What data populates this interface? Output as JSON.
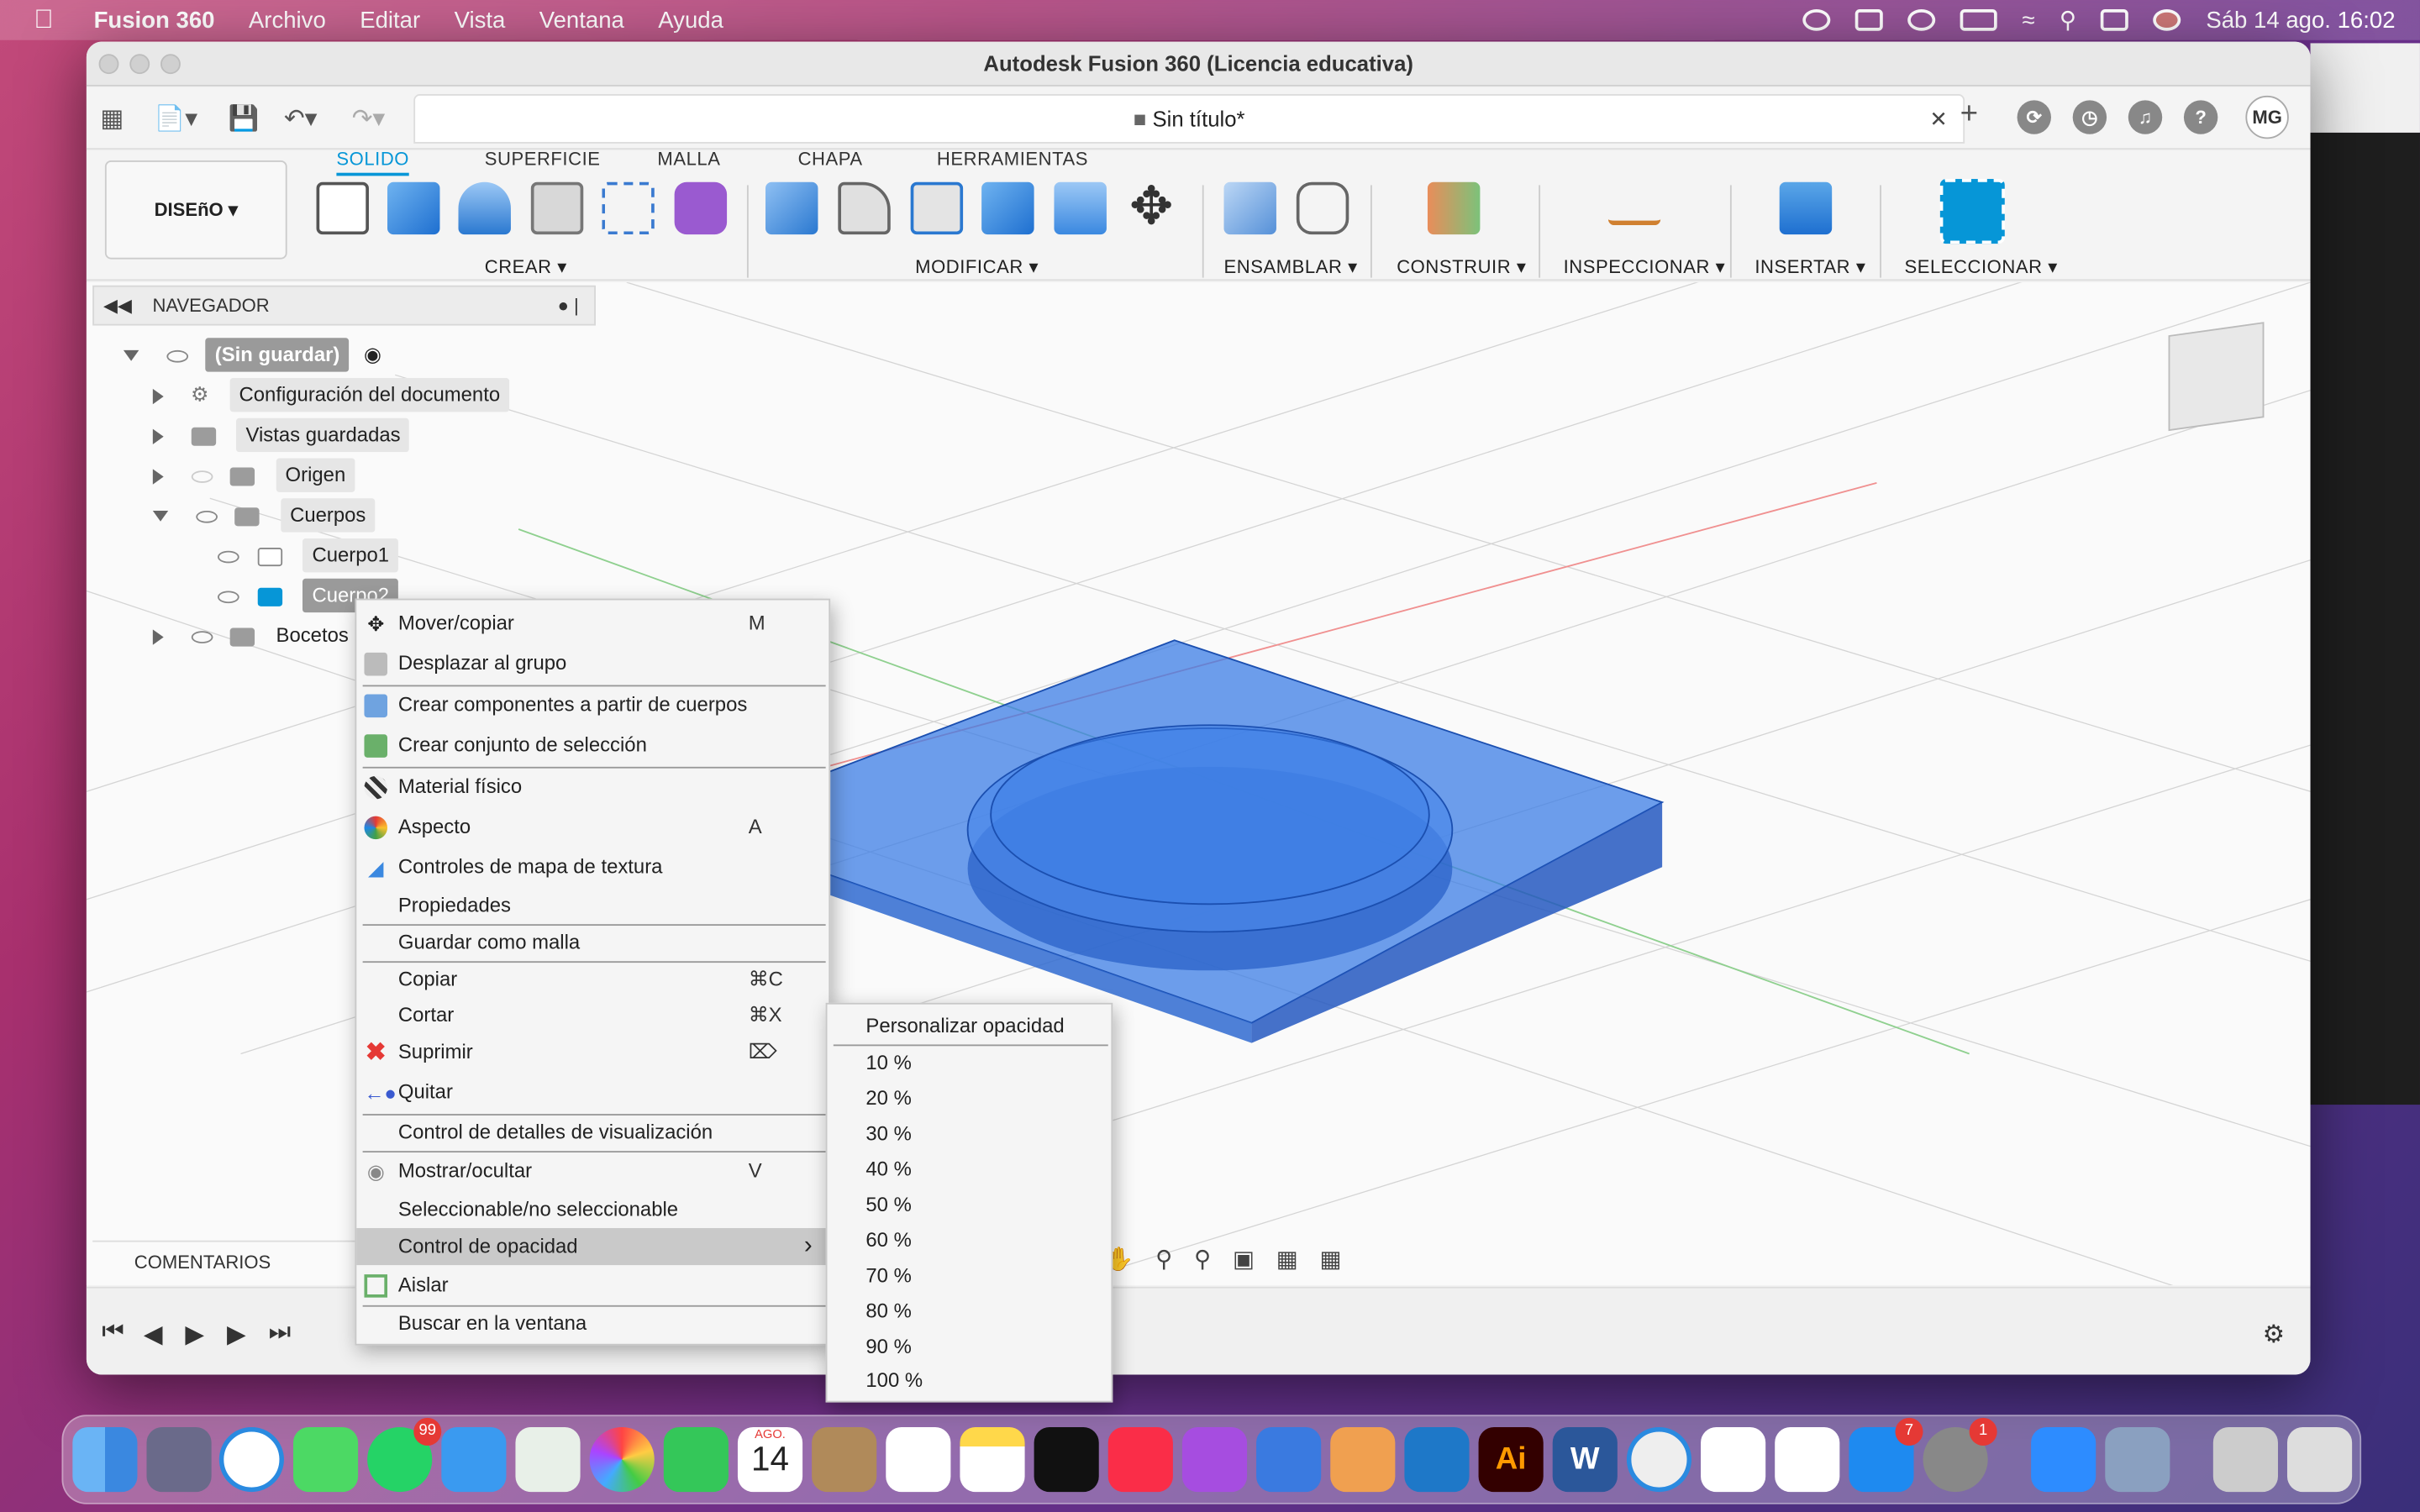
{
  "menubar": {
    "app_name": "Fusion 360",
    "menus": [
      "Archivo",
      "Editar",
      "Vista",
      "Ventana",
      "Ayuda"
    ],
    "clock": "Sáb 14 ago.  16:02"
  },
  "window": {
    "title": "Autodesk Fusion 360 (Licencia educativa)",
    "doc_tab": "Sin título*",
    "avatar": "MG"
  },
  "ribbon": {
    "workspace": "DISEñO ▾",
    "tabs": [
      "SOLIDO",
      "SUPERFICIE",
      "MALLA",
      "CHAPA",
      "HERRAMIENTAS"
    ],
    "active_tab": "SOLIDO",
    "groups": [
      "CREAR ▾",
      "MODIFICAR ▾",
      "ENSAMBLAR ▾",
      "CONSTRUIR ▾",
      "INSPECCIONAR ▾",
      "INSERTAR ▾",
      "SELECCIONAR ▾"
    ]
  },
  "navigator": {
    "title": "NAVEGADOR",
    "root": "(Sin guardar)",
    "items": {
      "doc_settings": "Configuración del documento",
      "saved_views": "Vistas guardadas",
      "origin": "Origen",
      "bodies": "Cuerpos",
      "body1": "Cuerpo1",
      "body2": "Cuerpo2",
      "sketches": "Bocetos"
    }
  },
  "comments_label": "COMENTARIOS",
  "context_menu": {
    "move_copy": {
      "label": "Mover/copiar",
      "shortcut": "M"
    },
    "move_group": {
      "label": "Desplazar al grupo"
    },
    "create_components": {
      "label": "Crear componentes a partir de cuerpos"
    },
    "create_selection_set": {
      "label": "Crear conjunto de selección"
    },
    "physical_material": {
      "label": "Material físico"
    },
    "appearance": {
      "label": "Aspecto",
      "shortcut": "A"
    },
    "texture_map": {
      "label": "Controles de mapa de textura"
    },
    "properties": {
      "label": "Propiedades"
    },
    "save_mesh": {
      "label": "Guardar como malla"
    },
    "copy": {
      "label": "Copiar",
      "shortcut": "⌘C"
    },
    "cut": {
      "label": "Cortar",
      "shortcut": "⌘X"
    },
    "delete": {
      "label": "Suprimir",
      "shortcut": "⌦"
    },
    "remove": {
      "label": "Quitar"
    },
    "display_detail": {
      "label": "Control de detalles de visualización"
    },
    "show_hide": {
      "label": "Mostrar/ocultar",
      "shortcut": "V"
    },
    "selectable": {
      "label": "Seleccionable/no seleccionable"
    },
    "opacity": {
      "label": "Control de opacidad"
    },
    "isolate": {
      "label": "Aislar"
    },
    "find_window": {
      "label": "Buscar en la ventana"
    }
  },
  "opacity_submenu": {
    "custom": "Personalizar opacidad",
    "options": [
      "10 %",
      "20 %",
      "30 %",
      "40 %",
      "50 %",
      "60 %",
      "70 %",
      "80 %",
      "90 %",
      "100 %"
    ]
  },
  "dock": {
    "calendar_month": "AGO.",
    "calendar_day": "14",
    "whatsapp_badge": "99",
    "appstore_badge": "7",
    "settings_badge": "1"
  },
  "colors": {
    "accent": "#0696d7",
    "body_blue": "#2f6fe0",
    "delete_red": "#e53935"
  }
}
